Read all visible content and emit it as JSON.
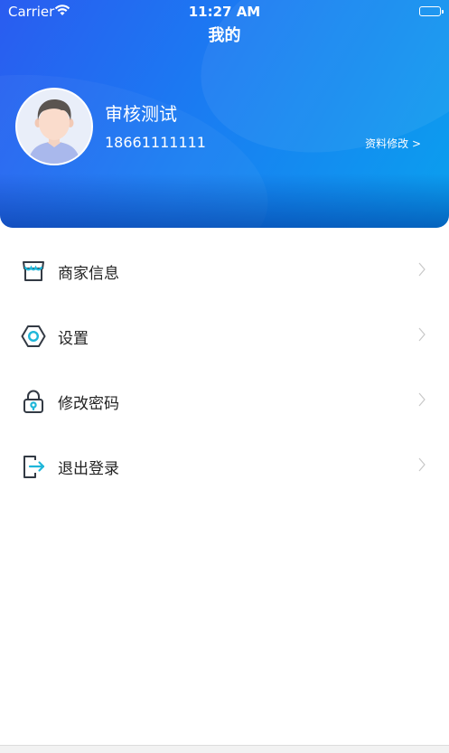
{
  "status_bar": {
    "carrier": "Carrier",
    "time": "11:27 AM",
    "battery_level": 1.0
  },
  "nav": {
    "title": "我的"
  },
  "profile": {
    "name": "审核测试",
    "phone": "18661111111",
    "edit_link": "资料修改 >"
  },
  "menu": {
    "items": [
      {
        "label": "商家信息",
        "icon": "store-icon"
      },
      {
        "label": "设置",
        "icon": "settings-hexagon-icon"
      },
      {
        "label": "修改密码",
        "icon": "lock-icon"
      },
      {
        "label": "退出登录",
        "icon": "logout-icon"
      }
    ]
  },
  "colors": {
    "header_start": "#2a5cf0",
    "header_end": "#0aa0ee",
    "icon_dark": "#333a44",
    "icon_accent": "#1fb6d9",
    "chevron": "#c8c8c8"
  }
}
